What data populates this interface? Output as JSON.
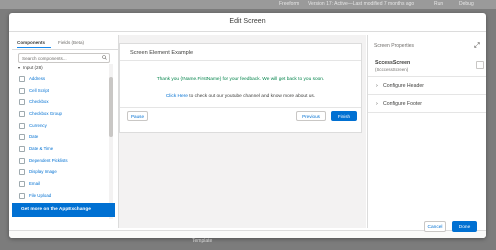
{
  "background": {
    "top_items": [
      "Freeform",
      "Version 17: Active—Last modified 7 months ago",
      "Run",
      "Debug"
    ],
    "bottom_text": "Template"
  },
  "modal": {
    "title": "Edit Screen",
    "footer": {
      "cancel_label": "Cancel",
      "done_label": "Done"
    }
  },
  "left_panel": {
    "tabs": [
      {
        "label": "Components",
        "active": true
      },
      {
        "label": "Fields (Beta)",
        "active": false
      }
    ],
    "search_placeholder": "Search components...",
    "group_label": "Input (28)",
    "items": [
      {
        "label": "Address",
        "icon": "address-icon"
      },
      {
        "label": "Cell Script",
        "icon": "script-icon"
      },
      {
        "label": "Checkbox",
        "icon": "checkbox-icon"
      },
      {
        "label": "Checkbox Group",
        "icon": "checkbox-group-icon"
      },
      {
        "label": "Currency",
        "icon": "currency-icon"
      },
      {
        "label": "Date",
        "icon": "date-icon"
      },
      {
        "label": "Date & Time",
        "icon": "datetime-icon"
      },
      {
        "label": "Dependent Picklists",
        "icon": "picklist-icon"
      },
      {
        "label": "Display Image",
        "icon": "image-icon"
      },
      {
        "label": "Email",
        "icon": "email-icon"
      },
      {
        "label": "File Upload",
        "icon": "upload-icon"
      }
    ],
    "appexchange_label": "Get more on the AppExchange"
  },
  "canvas": {
    "card_title": "Screen Element Example",
    "thanks_text": "Thank you {!Name.FirstName} for your feedback. We will get back to you soon.",
    "click_link": "Click Here",
    "click_rest": "to check out our youtube channel and know more about us.",
    "pause_label": "Pause",
    "previous_label": "Previous",
    "finish_label": "Finish"
  },
  "right_panel": {
    "title": "Screen Properties",
    "screen_name": "SccessScreen",
    "screen_api": "(ScccessScreen)",
    "sections": [
      "Configure Header",
      "Configure Footer"
    ]
  },
  "colors": {
    "accent": "#0070d2",
    "success_text": "#04844b"
  }
}
